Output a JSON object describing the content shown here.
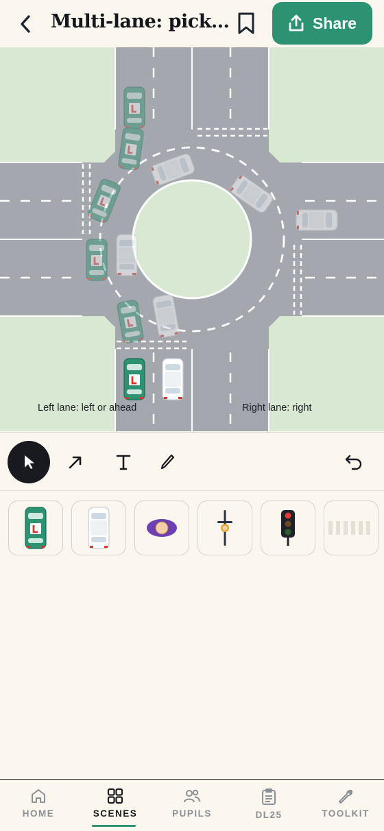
{
  "header": {
    "title": "Multi-lane: pick your lane",
    "share_label": "Share",
    "icons": [
      "chevron-left-icon",
      "bookmark-icon",
      "share-upload-icon"
    ]
  },
  "scene": {
    "left_lane_label": "Left lane: left or ahead",
    "right_lane_label": "Right lane: right",
    "colors": {
      "grass": "#d9e8d2",
      "road": "#a4a7ae",
      "learner_car": "#2d9272",
      "other_car": "#ffffff"
    }
  },
  "tools": [
    {
      "name": "select",
      "icon": "pointer-icon",
      "active": true
    },
    {
      "name": "arrow",
      "icon": "arrow-icon",
      "active": false
    },
    {
      "name": "text",
      "icon": "text-icon",
      "active": false
    },
    {
      "name": "pen",
      "icon": "pen-icon",
      "active": false
    },
    {
      "name": "undo",
      "icon": "undo-icon",
      "active": false
    }
  ],
  "palette": [
    {
      "name": "learner-car",
      "icon": "learner-car-icon"
    },
    {
      "name": "white-car",
      "icon": "white-car-icon"
    },
    {
      "name": "pedestrian",
      "icon": "pedestrian-icon"
    },
    {
      "name": "cyclist",
      "icon": "cyclist-icon"
    },
    {
      "name": "traffic-light",
      "icon": "traffic-light-icon"
    },
    {
      "name": "zebra-crossing",
      "icon": "zebra-crossing-icon"
    }
  ],
  "nav": {
    "items": [
      {
        "label": "HOME",
        "icon": "home-icon",
        "active": false
      },
      {
        "label": "SCENES",
        "icon": "grid-icon",
        "active": true
      },
      {
        "label": "PUPILS",
        "icon": "people-icon",
        "active": false
      },
      {
        "label": "DL25",
        "icon": "clipboard-icon",
        "active": false
      },
      {
        "label": "TOOLKIT",
        "icon": "wrench-icon",
        "active": false
      }
    ]
  }
}
